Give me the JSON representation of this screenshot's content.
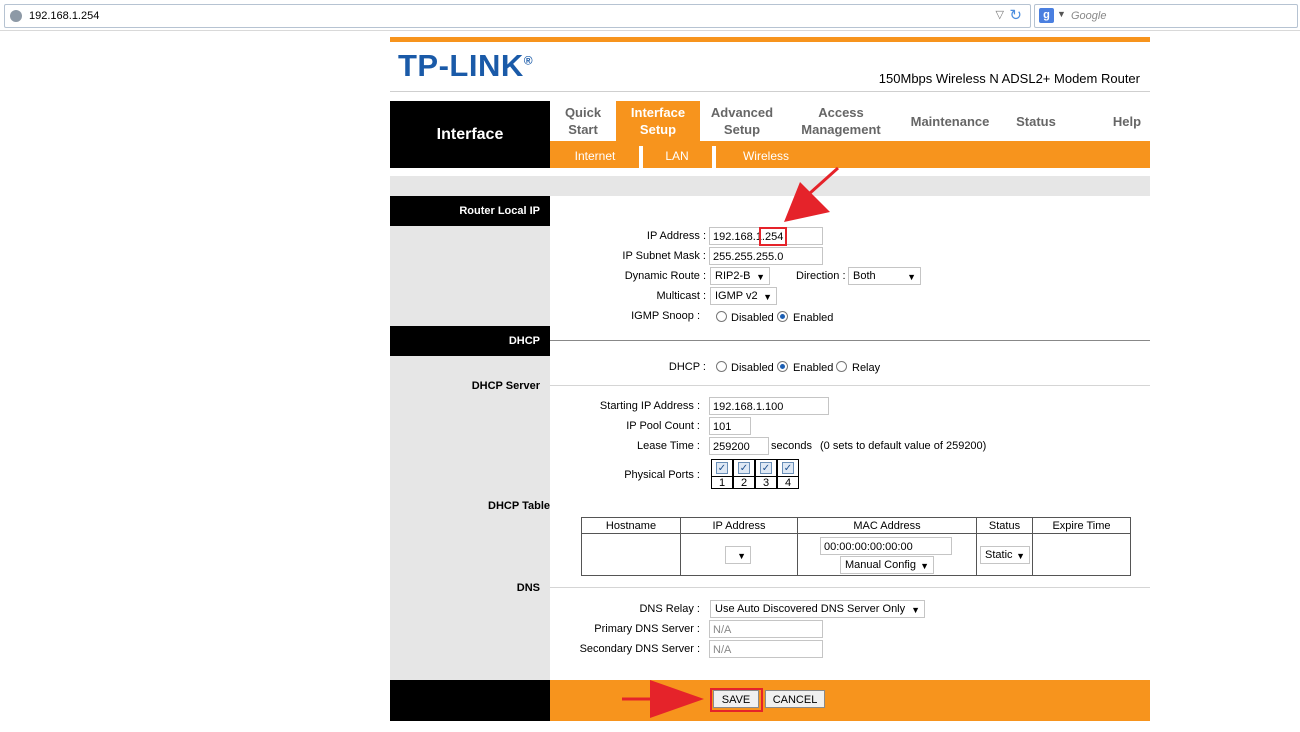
{
  "browser": {
    "url": "192.168.1.254",
    "search_placeholder": "Google",
    "search_engine_label": "g"
  },
  "header": {
    "logo": "TP-LINK",
    "logo_mark": "®",
    "model": "150Mbps Wireless N ADSL2+ Modem Router"
  },
  "nav": {
    "section_title": "Interface",
    "items": [
      {
        "label": "Quick\nStart"
      },
      {
        "label": "Interface\nSetup"
      },
      {
        "label": "Advanced\nSetup"
      },
      {
        "label": "Access\nManagement"
      },
      {
        "label": "Maintenance"
      },
      {
        "label": "Status"
      },
      {
        "label": "Help"
      }
    ],
    "active_index": 1,
    "subitems": [
      {
        "label": "Internet"
      },
      {
        "label": "LAN"
      },
      {
        "label": "Wireless"
      }
    ]
  },
  "router_local_ip": {
    "section_label": "Router Local IP",
    "ip_address_label": "IP Address :",
    "ip_address_value": "192.168.1.254",
    "ip_address_highlight": "254",
    "subnet_label": "IP Subnet Mask :",
    "subnet_value": "255.255.255.0",
    "dynamic_route_label": "Dynamic Route :",
    "dynamic_route_value": "RIP2-B",
    "direction_label": "Direction :",
    "direction_value": "Both",
    "multicast_label": "Multicast :",
    "multicast_value": "IGMP v2",
    "igmp_snoop_label": "IGMP Snoop :",
    "igmp_disabled": "Disabled",
    "igmp_enabled": "Enabled",
    "igmp_selected": "Enabled"
  },
  "dhcp": {
    "section_label": "DHCP",
    "dhcp_label": "DHCP :",
    "options": [
      "Disabled",
      "Enabled",
      "Relay"
    ],
    "selected": "Enabled",
    "server_label": "DHCP Server",
    "start_ip_label": "Starting IP Address :",
    "start_ip_value": "192.168.1.100",
    "pool_count_label": "IP Pool Count :",
    "pool_count_value": "101",
    "lease_label": "Lease Time :",
    "lease_value": "259200",
    "lease_unit": "seconds",
    "lease_hint": "(0 sets to default value of 259200)",
    "ports_label": "Physical Ports :",
    "ports": [
      "1",
      "2",
      "3",
      "4"
    ],
    "table_label": "DHCP Table",
    "table_headers": [
      "Hostname",
      "IP Address",
      "MAC Address",
      "Status",
      "Expire Time"
    ],
    "mac_value": "00:00:00:00:00:00",
    "mac_mode": "Manual Config",
    "status_value": "Static"
  },
  "dns": {
    "section_label": "DNS",
    "relay_label": "DNS Relay :",
    "relay_value": "Use Auto Discovered DNS Server Only",
    "primary_label": "Primary DNS Server :",
    "primary_value": "N/A",
    "secondary_label": "Secondary DNS Server :",
    "secondary_value": "N/A"
  },
  "actions": {
    "save": "SAVE",
    "cancel": "CANCEL"
  },
  "colors": {
    "brand_orange": "#f7941d",
    "logo_blue": "#1a5aa8",
    "annotation_red": "#e5232a"
  }
}
